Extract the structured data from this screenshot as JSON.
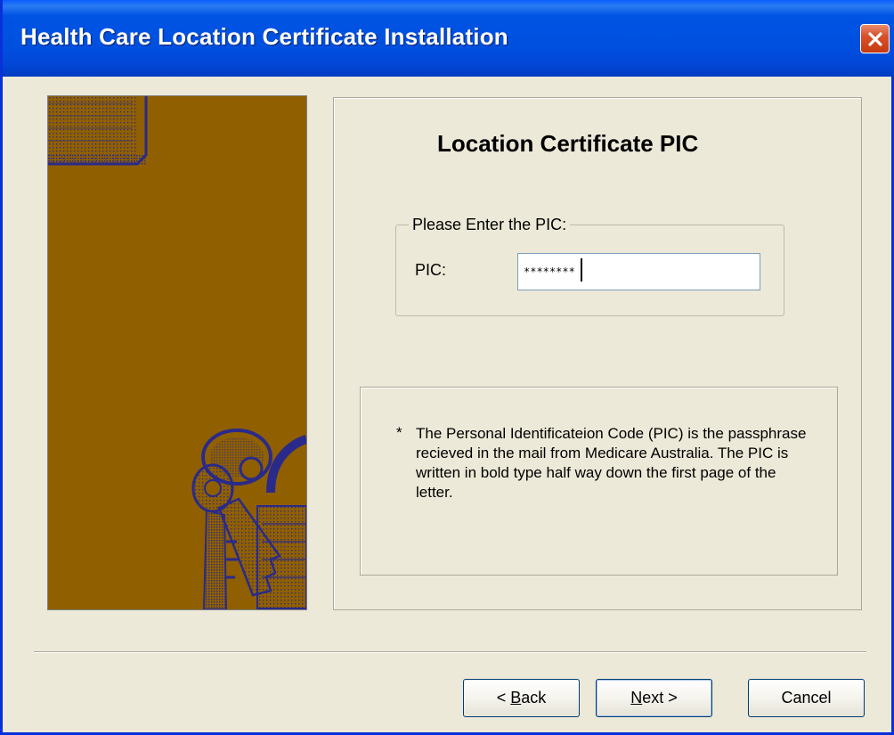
{
  "window": {
    "title": "Health Care Location Certificate Installation"
  },
  "page": {
    "heading": "Location Certificate PIC"
  },
  "pic_group": {
    "legend": "Please Enter the PIC:",
    "field_label": "PIC:",
    "field_value": "********"
  },
  "note": {
    "bullet": "*",
    "text": "The Personal Identificateion Code (PIC) is the passphrase recieved in the mail from Medicare Australia.  The PIC is written in bold type half way down the first page of the letter."
  },
  "buttons": {
    "back_prefix": "< ",
    "back_mnemonic": "B",
    "back_rest": "ack",
    "next_mnemonic": "N",
    "next_rest": "ext >",
    "cancel": "Cancel"
  },
  "colors": {
    "titlebar": "#0054e3",
    "window_bg": "#ece9d8",
    "art_bg": "#8f5f00",
    "art_ink": "#2a2a8a",
    "close_button": "#c63a12"
  },
  "icons": {
    "close": "close-icon",
    "wizard_art": "padlock-and-keys-illustration"
  }
}
